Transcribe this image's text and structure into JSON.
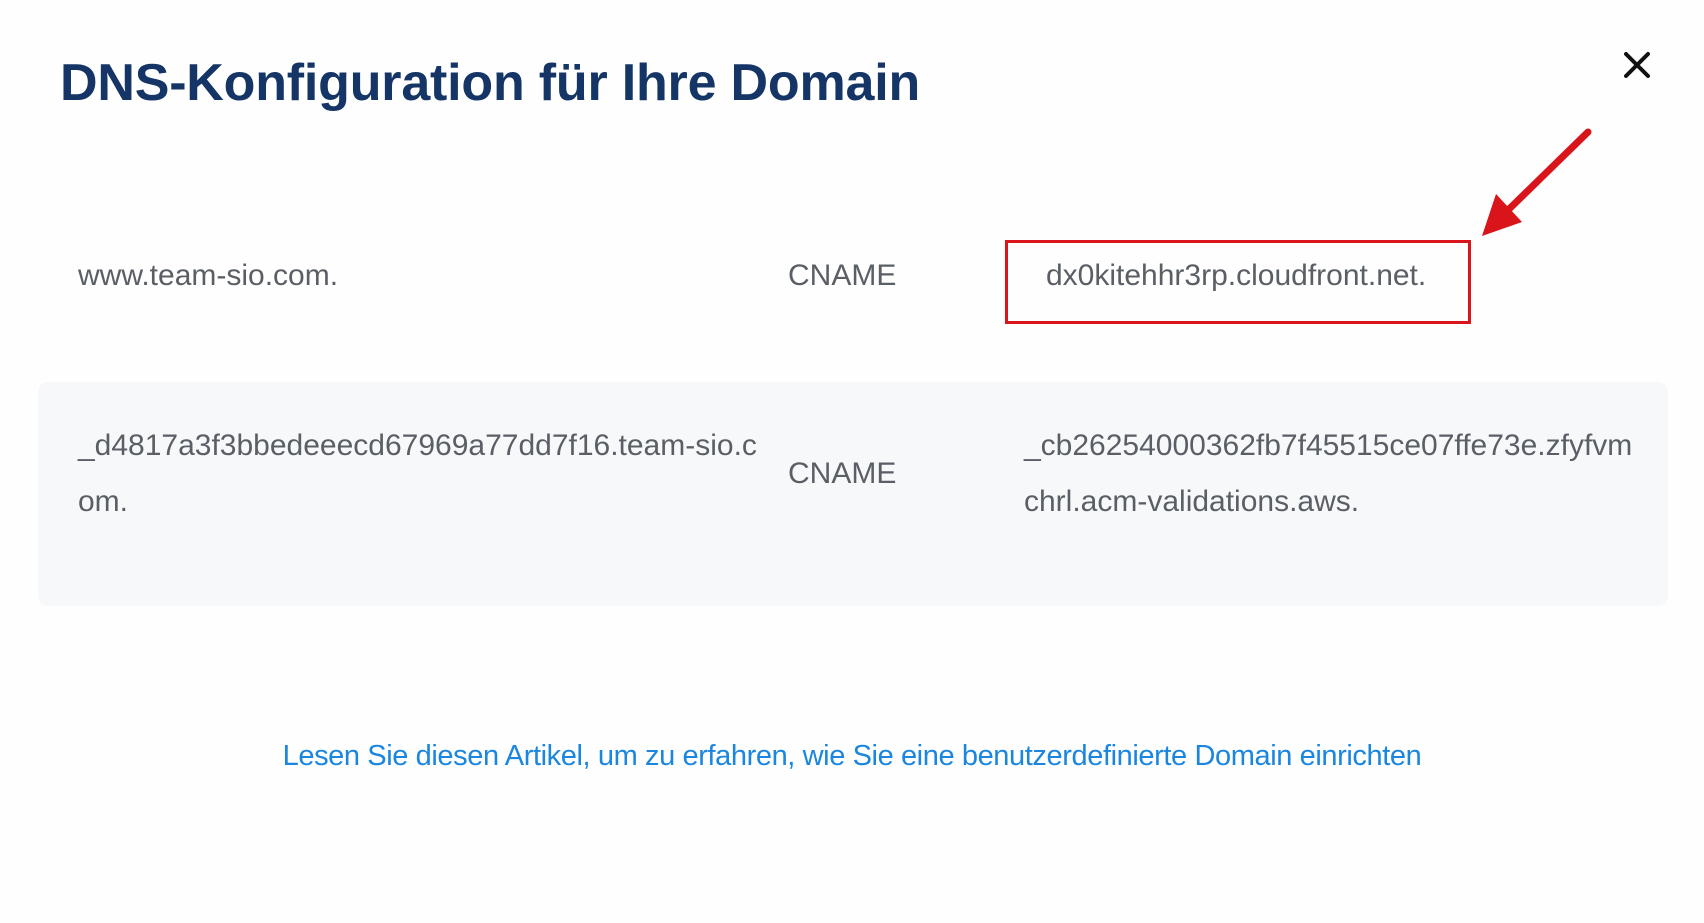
{
  "dialog": {
    "title": "DNS-Konfiguration für Ihre Domain",
    "close_icon": "close-icon"
  },
  "dns_records": [
    {
      "name": "www.team-sio.com.",
      "type": "CNAME",
      "value": "dx0kitehhr3rp.cloudfront.net.",
      "highlighted": true
    },
    {
      "name": "_d4817a3f3bbedeeecd67969a77dd7f16.team-sio.com.",
      "type": "CNAME",
      "value": "_cb26254000362fb7f45515ce07ffe73e.zfyfvmchrl.acm-validations.aws.",
      "highlighted": false
    }
  ],
  "annotation": {
    "icon": "red-arrow-icon",
    "color": "#d9141b"
  },
  "help_link": {
    "label": "Lesen Sie diesen Artikel, um zu erfahren, wie Sie eine benutzerdefinierte Domain einrichten",
    "color": "#1a86df"
  },
  "colors": {
    "title": "#143565",
    "text": "#5a5f66",
    "row_alt_background": "#f7f8fa"
  }
}
